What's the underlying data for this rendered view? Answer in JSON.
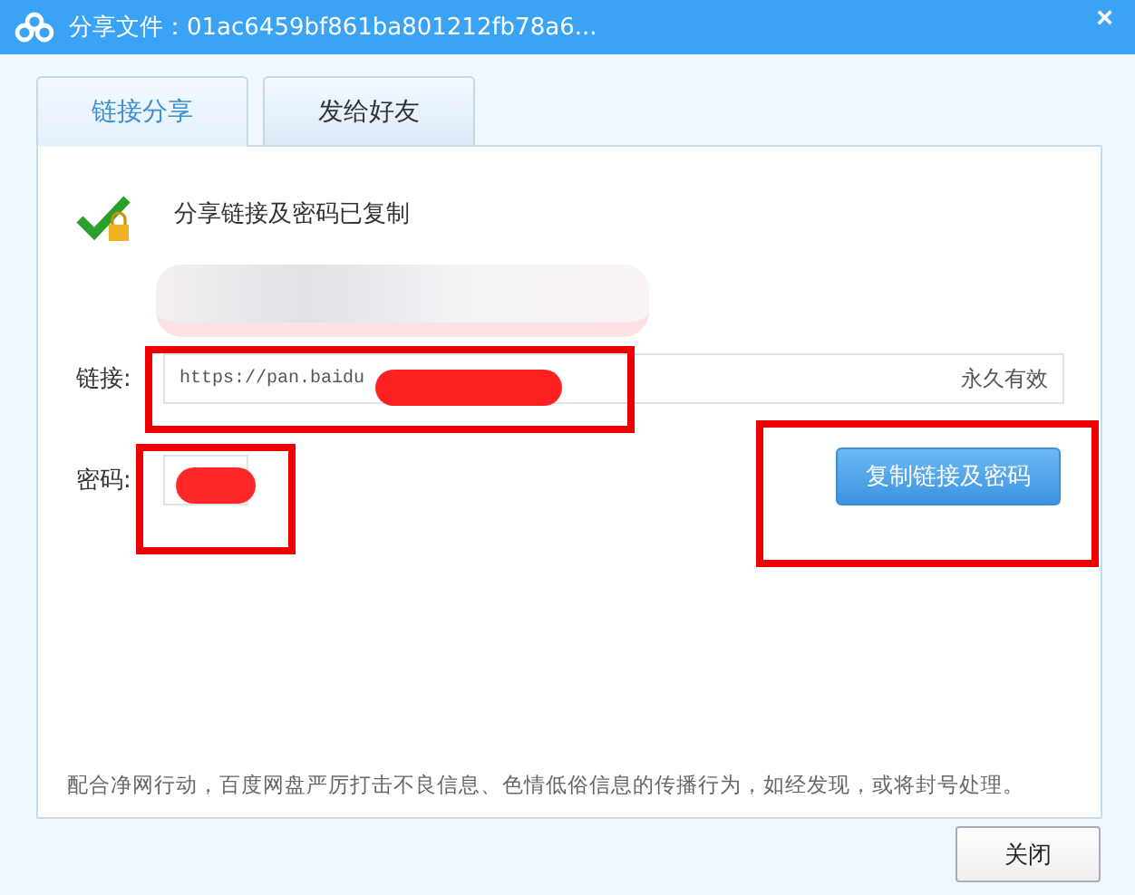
{
  "window": {
    "title": "分享文件：01ac6459bf861ba801212fb78a6...",
    "close": "×"
  },
  "tabs": [
    {
      "label": "链接分享",
      "selected": true
    },
    {
      "label": "发给好友",
      "selected": false
    }
  ],
  "status": {
    "message": "分享链接及密码已复制"
  },
  "link": {
    "label": "链接:",
    "value": "https://pan.baidu",
    "validity": "永久有效"
  },
  "password": {
    "label": "密码:"
  },
  "copy_button": "复制链接及密码",
  "notice": "配合净网行动，百度网盘严厉打击不良信息、色情低俗信息的传播行为，如经发现，或将封号处理。",
  "close_button": "关闭"
}
